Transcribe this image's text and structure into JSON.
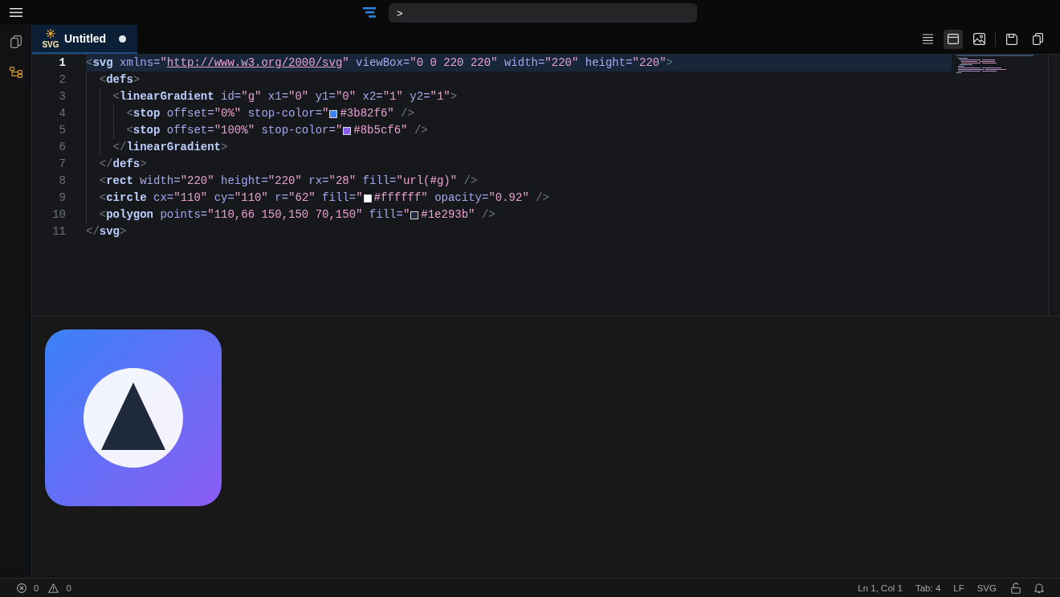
{
  "top_bar": {
    "command": {
      "value": ">"
    }
  },
  "tabs": [
    {
      "title": "Untitled",
      "icon_text": "SVG",
      "modified": true,
      "selected": true
    }
  ],
  "view_modes": [
    {
      "selected": false
    },
    {
      "selected": true
    },
    {
      "selected": false
    }
  ],
  "editor": {
    "lines": [
      {
        "number": "1",
        "current": true,
        "tokens": [
          {
            "kind": "punct",
            "text": "<"
          },
          {
            "kind": "tag",
            "text": "svg"
          },
          {
            "kind": "attr",
            "text": " xmlns="
          },
          {
            "kind": "string",
            "text": "\""
          },
          {
            "kind": "link",
            "text": "http://www.w3.org/2000/svg"
          },
          {
            "kind": "string",
            "text": "\""
          },
          {
            "kind": "attr",
            "text": " viewBox="
          },
          {
            "kind": "string",
            "text": "\"0 0 220 220\""
          },
          {
            "kind": "attr",
            "text": " width="
          },
          {
            "kind": "string",
            "text": "\"220\""
          },
          {
            "kind": "attr",
            "text": " height="
          },
          {
            "kind": "string",
            "text": "\"220\""
          },
          {
            "kind": "punct",
            "text": ">"
          }
        ],
        "children": [
          {
            "number": "2",
            "current": false,
            "tokens": [
              {
                "kind": "punct",
                "text": "<"
              },
              {
                "kind": "tag",
                "text": "defs"
              },
              {
                "kind": "punct",
                "text": ">"
              }
            ],
            "children": [
              {
                "number": "3",
                "current": false,
                "tokens": [
                  {
                    "kind": "punct",
                    "text": "<"
                  },
                  {
                    "kind": "tag",
                    "text": "linearGradient"
                  },
                  {
                    "kind": "attr",
                    "text": " id="
                  },
                  {
                    "kind": "string",
                    "text": "\"g\""
                  },
                  {
                    "kind": "attr",
                    "text": " x1="
                  },
                  {
                    "kind": "string",
                    "text": "\"0\""
                  },
                  {
                    "kind": "attr",
                    "text": " y1="
                  },
                  {
                    "kind": "string",
                    "text": "\"0\""
                  },
                  {
                    "kind": "attr",
                    "text": " x2="
                  },
                  {
                    "kind": "string",
                    "text": "\"1\""
                  },
                  {
                    "kind": "attr",
                    "text": " y2="
                  },
                  {
                    "kind": "string",
                    "text": "\"1\""
                  },
                  {
                    "kind": "punct",
                    "text": ">"
                  }
                ],
                "children": [
                  {
                    "number": "4",
                    "current": false,
                    "tokens": [
                      {
                        "kind": "punct",
                        "text": "<"
                      },
                      {
                        "kind": "tag",
                        "text": "stop"
                      },
                      {
                        "kind": "attr",
                        "text": " offset="
                      },
                      {
                        "kind": "string",
                        "text": "\"0%\""
                      },
                      {
                        "kind": "attr",
                        "text": " stop-color="
                      },
                      {
                        "kind": "string",
                        "text": "\""
                      },
                      {
                        "kind": "swatch",
                        "color": "#3b82f6"
                      },
                      {
                        "kind": "string",
                        "text": "#3b82f6\""
                      },
                      {
                        "kind": "punct",
                        "text": " />"
                      }
                    ]
                  },
                  {
                    "number": "5",
                    "current": false,
                    "tokens": [
                      {
                        "kind": "punct",
                        "text": "<"
                      },
                      {
                        "kind": "tag",
                        "text": "stop"
                      },
                      {
                        "kind": "attr",
                        "text": " offset="
                      },
                      {
                        "kind": "string",
                        "text": "\"100%\""
                      },
                      {
                        "kind": "attr",
                        "text": " stop-color="
                      },
                      {
                        "kind": "string",
                        "text": "\""
                      },
                      {
                        "kind": "swatch",
                        "color": "#8b5cf6"
                      },
                      {
                        "kind": "string",
                        "text": "#8b5cf6\""
                      },
                      {
                        "kind": "punct",
                        "text": " />"
                      }
                    ]
                  }
                ]
              },
              {
                "number": "6",
                "current": false,
                "tokens": [
                  {
                    "kind": "punct",
                    "text": "</"
                  },
                  {
                    "kind": "tag",
                    "text": "linearGradient"
                  },
                  {
                    "kind": "punct",
                    "text": ">"
                  }
                ]
              }
            ]
          },
          {
            "number": "7",
            "current": false,
            "tokens": [
              {
                "kind": "punct",
                "text": "</"
              },
              {
                "kind": "tag",
                "text": "defs"
              },
              {
                "kind": "punct",
                "text": ">"
              }
            ]
          },
          {
            "number": "8",
            "current": false,
            "tokens": [
              {
                "kind": "punct",
                "text": "<"
              },
              {
                "kind": "tag",
                "text": "rect"
              },
              {
                "kind": "attr",
                "text": " width="
              },
              {
                "kind": "string",
                "text": "\"220\""
              },
              {
                "kind": "attr",
                "text": " height="
              },
              {
                "kind": "string",
                "text": "\"220\""
              },
              {
                "kind": "attr",
                "text": " rx="
              },
              {
                "kind": "string",
                "text": "\"28\""
              },
              {
                "kind": "attr",
                "text": " fill="
              },
              {
                "kind": "string",
                "text": "\"url(#g)\""
              },
              {
                "kind": "punct",
                "text": " />"
              }
            ]
          },
          {
            "number": "9",
            "current": false,
            "tokens": [
              {
                "kind": "punct",
                "text": "<"
              },
              {
                "kind": "tag",
                "text": "circle"
              },
              {
                "kind": "attr",
                "text": " cx="
              },
              {
                "kind": "string",
                "text": "\"110\""
              },
              {
                "kind": "attr",
                "text": " cy="
              },
              {
                "kind": "string",
                "text": "\"110\""
              },
              {
                "kind": "attr",
                "text": " r="
              },
              {
                "kind": "string",
                "text": "\"62\""
              },
              {
                "kind": "attr",
                "text": " fill="
              },
              {
                "kind": "string",
                "text": "\""
              },
              {
                "kind": "swatch",
                "color": "#ffffff"
              },
              {
                "kind": "string",
                "text": "#ffffff\""
              },
              {
                "kind": "attr",
                "text": " opacity="
              },
              {
                "kind": "string",
                "text": "\"0.92\""
              },
              {
                "kind": "punct",
                "text": " />"
              }
            ]
          },
          {
            "number": "10",
            "current": false,
            "tokens": [
              {
                "kind": "punct",
                "text": "<"
              },
              {
                "kind": "tag",
                "text": "polygon"
              },
              {
                "kind": "attr",
                "text": " points="
              },
              {
                "kind": "string",
                "text": "\"110,66 150,150 70,150\""
              },
              {
                "kind": "attr",
                "text": " fill="
              },
              {
                "kind": "string",
                "text": "\""
              },
              {
                "kind": "swatch",
                "color": "#1e293b"
              },
              {
                "kind": "string",
                "text": "#1e293b\""
              },
              {
                "kind": "punct",
                "text": " />"
              }
            ]
          }
        ]
      },
      {
        "number": "11",
        "current": false,
        "tokens": [
          {
            "kind": "punct",
            "text": "</"
          },
          {
            "kind": "tag",
            "text": "svg"
          },
          {
            "kind": "punct",
            "text": ">"
          }
        ]
      }
    ]
  },
  "status_bar": {
    "errors": "0",
    "warnings": "0",
    "position": "Ln 1, Col 1",
    "indent": "Tab: 4",
    "line_ending": "LF",
    "language": "SVG",
    "locked": false
  }
}
